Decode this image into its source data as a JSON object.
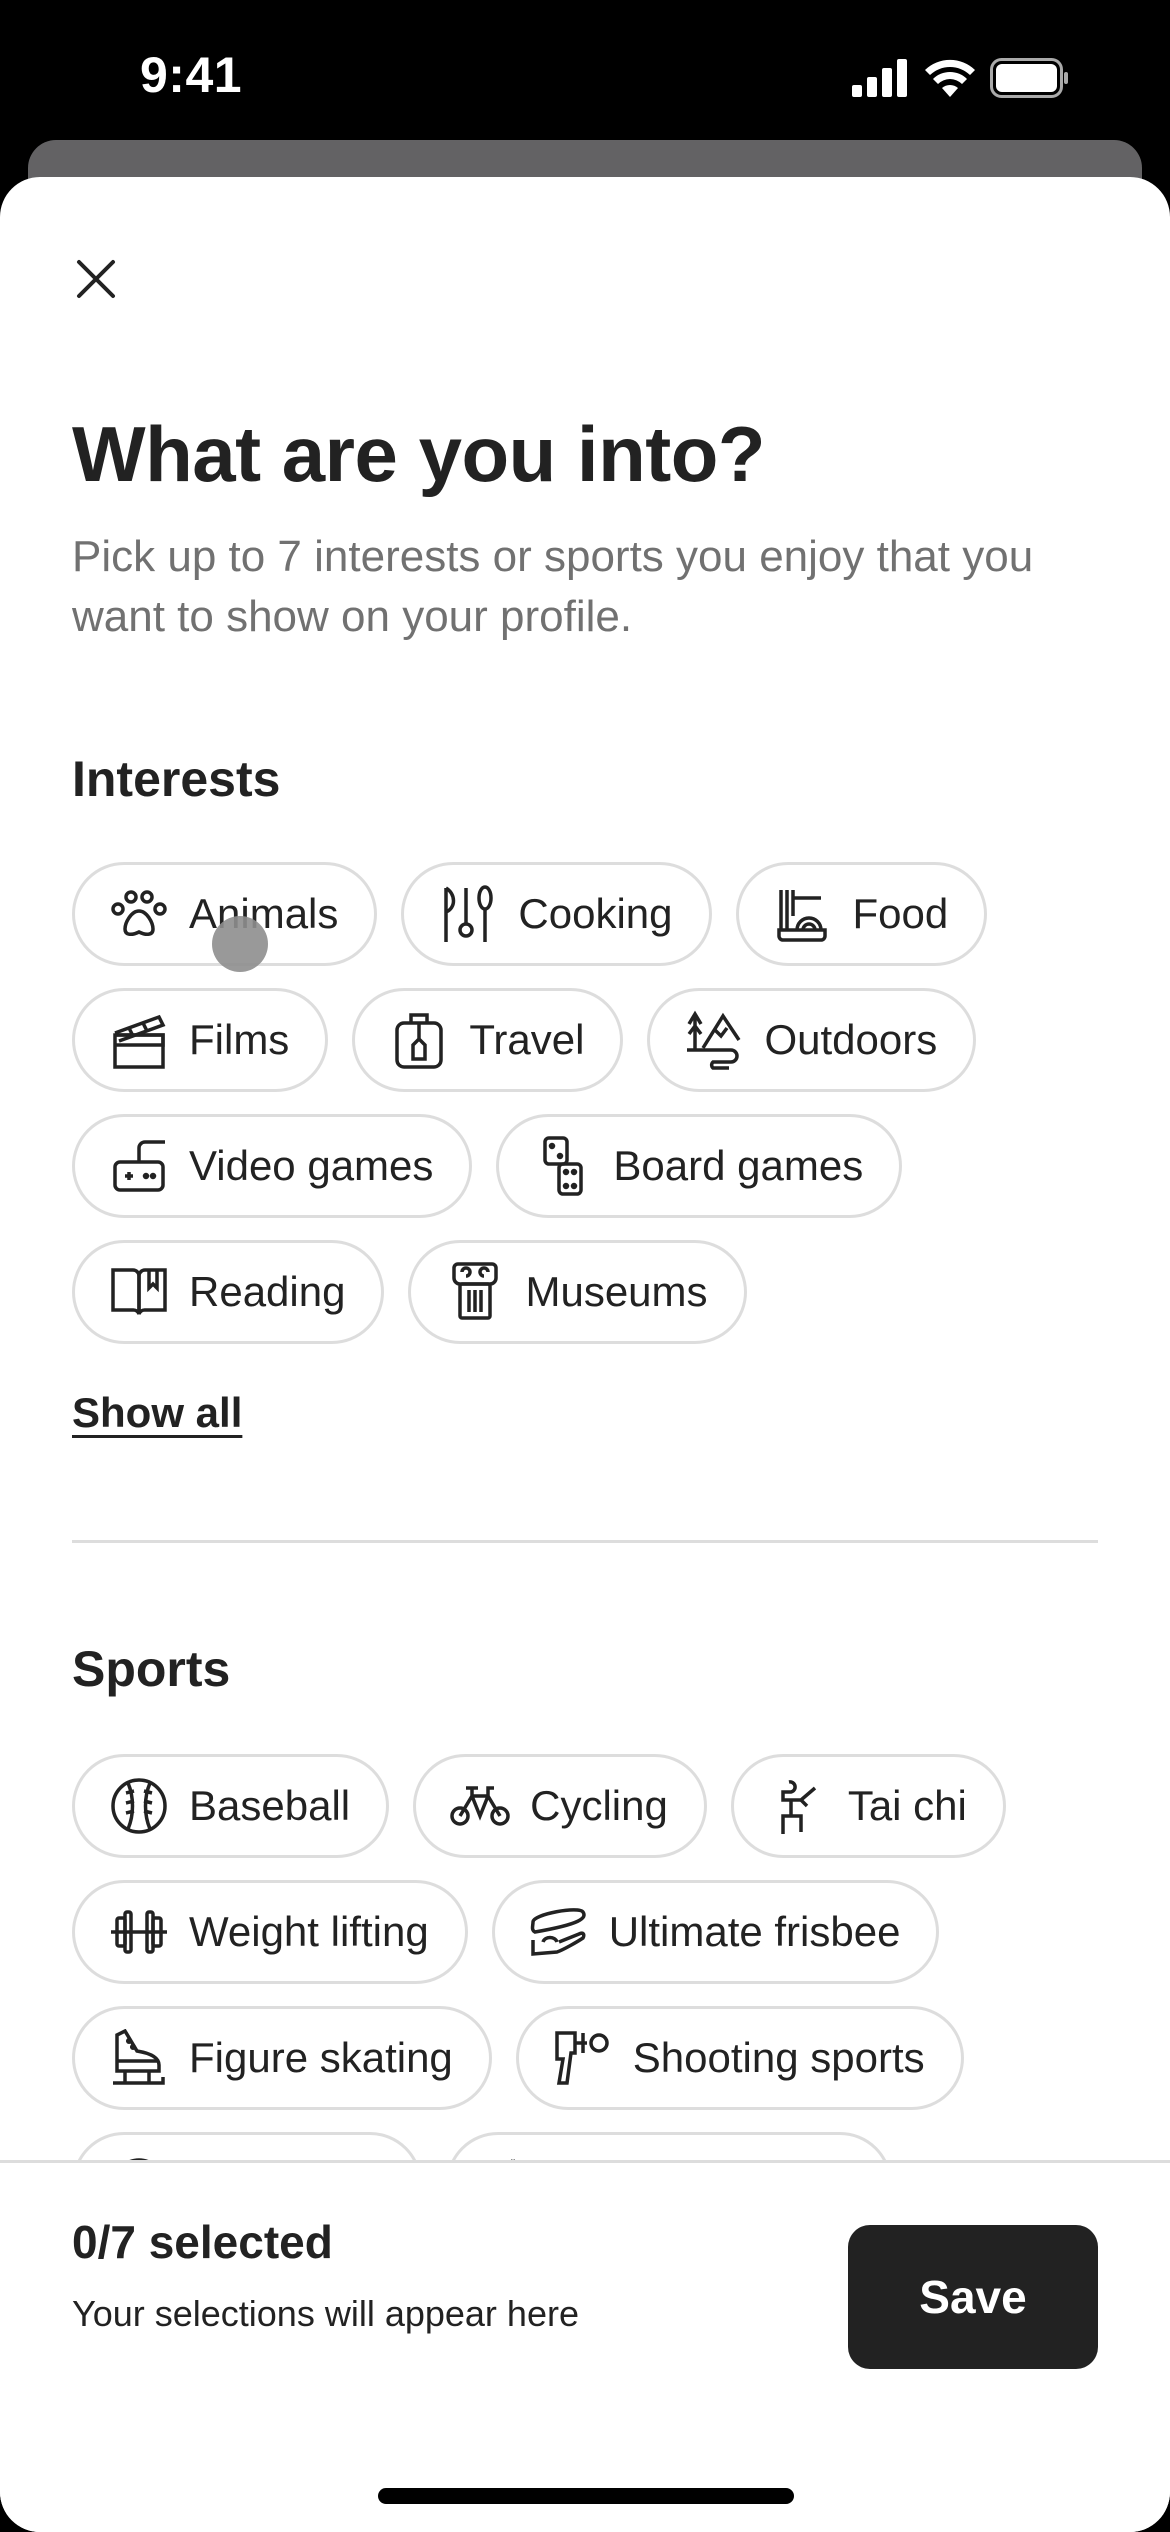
{
  "status_bar": {
    "time": "9:41",
    "icons": [
      "signal-icon",
      "wifi-icon",
      "battery-icon"
    ]
  },
  "modal": {
    "close_icon": "close-icon",
    "title": "What are you into?",
    "subtitle": "Pick up to 7 interests or sports you enjoy that you want to show on your profile."
  },
  "interests": {
    "heading": "Interests",
    "items": [
      {
        "label": "Animals",
        "icon": "paw-icon"
      },
      {
        "label": "Cooking",
        "icon": "utensils-icon"
      },
      {
        "label": "Food",
        "icon": "noodles-icon"
      },
      {
        "label": "Films",
        "icon": "clapperboard-icon"
      },
      {
        "label": "Travel",
        "icon": "luggage-icon"
      },
      {
        "label": "Outdoors",
        "icon": "mountain-tree-icon"
      },
      {
        "label": "Video games",
        "icon": "gamepad-icon"
      },
      {
        "label": "Board games",
        "icon": "dice-icon"
      },
      {
        "label": "Reading",
        "icon": "book-icon"
      },
      {
        "label": "Museums",
        "icon": "column-icon"
      }
    ],
    "show_all": "Show all"
  },
  "sports": {
    "heading": "Sports",
    "items": [
      {
        "label": "Baseball",
        "icon": "baseball-icon"
      },
      {
        "label": "Cycling",
        "icon": "bicycle-icon"
      },
      {
        "label": "Tai chi",
        "icon": "tai-chi-icon"
      },
      {
        "label": "Weight lifting",
        "icon": "dumbbell-icon"
      },
      {
        "label": "Ultimate frisbee",
        "icon": "frisbee-icon"
      },
      {
        "label": "Figure skating",
        "icon": "ice-skate-icon"
      },
      {
        "label": "Shooting sports",
        "icon": "target-gun-icon"
      }
    ]
  },
  "footer": {
    "selected_count": "0/7 selected",
    "hint": "Your selections will appear here",
    "save_label": "Save"
  },
  "colors": {
    "text_primary": "#222222",
    "text_secondary": "#717171",
    "chip_border": "#dddddd",
    "button_bg": "#222222",
    "button_text": "#ffffff"
  }
}
